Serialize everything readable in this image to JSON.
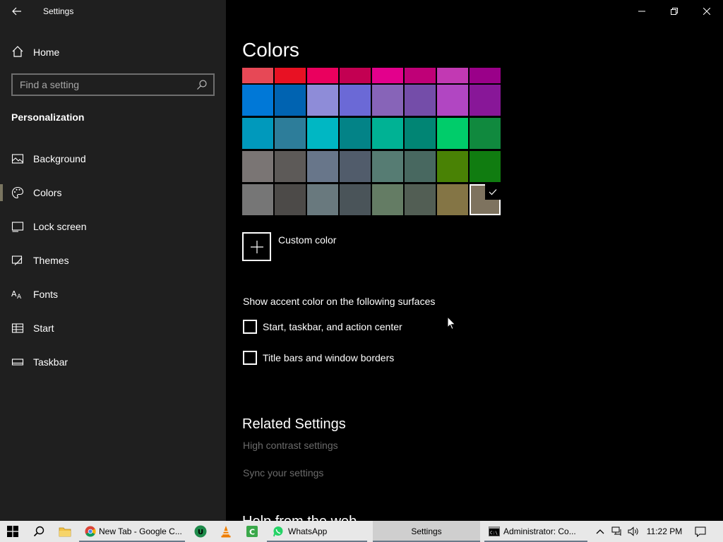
{
  "window": {
    "title": "Settings"
  },
  "sidebar": {
    "home_label": "Home",
    "search_placeholder": "Find a setting",
    "section_title": "Personalization",
    "items": [
      {
        "label": "Background",
        "icon": "picture-icon",
        "active": false
      },
      {
        "label": "Colors",
        "icon": "palette-icon",
        "active": true
      },
      {
        "label": "Lock screen",
        "icon": "lock-screen-icon",
        "active": false
      },
      {
        "label": "Themes",
        "icon": "brush-icon",
        "active": false
      },
      {
        "label": "Fonts",
        "icon": "font-icon",
        "active": false
      },
      {
        "label": "Start",
        "icon": "start-icon",
        "active": false
      },
      {
        "label": "Taskbar",
        "icon": "taskbar-icon",
        "active": false
      }
    ]
  },
  "main": {
    "title": "Colors",
    "swatches": [
      [
        "#e74856",
        "#e81123",
        "#ea005e",
        "#c30052",
        "#e3008c",
        "#bf0077",
        "#c239b3",
        "#9a0089"
      ],
      [
        "#0078d7",
        "#0063b1",
        "#8e8cd8",
        "#6b69d6",
        "#8764b8",
        "#744da9",
        "#b146c2",
        "#881798"
      ],
      [
        "#0099bc",
        "#2d7d9a",
        "#00b7c3",
        "#038387",
        "#00b294",
        "#018574",
        "#00cc6a",
        "#10893e"
      ],
      [
        "#7a7574",
        "#5d5a58",
        "#68768a",
        "#515c6b",
        "#567c73",
        "#486860",
        "#498205",
        "#107c10"
      ],
      [
        "#767676",
        "#4c4a48",
        "#69797e",
        "#4a5459",
        "#647c64",
        "#525e54",
        "#847545",
        "#7e735f"
      ]
    ],
    "selected_swatch": "#7e735f",
    "custom_color_label": "Custom color",
    "surfaces_label": "Show accent color on the following surfaces",
    "checkbox_start": "Start, taskbar, and action center",
    "checkbox_titlebars": "Title bars and window borders",
    "related_title": "Related Settings",
    "link_contrast": "High contrast settings",
    "link_sync": "Sync your settings",
    "help_title": "Help from the web"
  },
  "taskbar": {
    "chrome_label": "New Tab - Google C...",
    "whatsapp_label": "WhatsApp",
    "settings_label": "Settings",
    "cmd_label": "Administrator:  Co...",
    "clock": "11:22 PM"
  }
}
